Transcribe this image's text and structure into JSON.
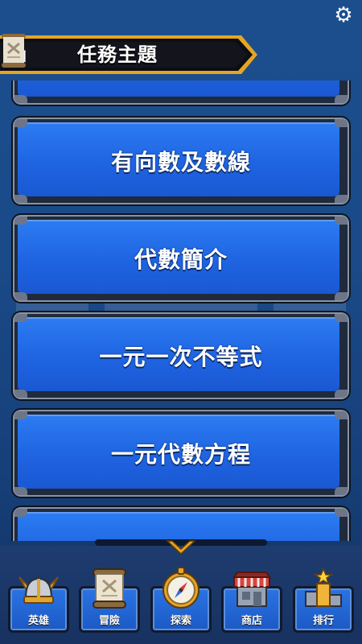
{
  "header": {
    "title": "任務主題",
    "back_label": "◀"
  },
  "topics": [
    {
      "label": ""
    },
    {
      "label": "有向數及數線"
    },
    {
      "label": "代數簡介"
    },
    {
      "label": "一元一次不等式"
    },
    {
      "label": "一元代數方程"
    },
    {
      "label": ""
    }
  ],
  "nav": {
    "items": [
      {
        "label": "英雄",
        "icon": "viking-helmet-icon"
      },
      {
        "label": "冒險",
        "icon": "scroll-icon"
      },
      {
        "label": "探索",
        "icon": "compass-icon"
      },
      {
        "label": "商店",
        "icon": "shop-icon"
      },
      {
        "label": "排行",
        "icon": "trophy-podium-icon"
      }
    ]
  },
  "colors": {
    "background": "#1c4e8e",
    "card_face": "#2c7cf2",
    "card_frame": "#1f2b3d",
    "header_bar": "#0d0d14",
    "header_trim": "#e6a521"
  }
}
